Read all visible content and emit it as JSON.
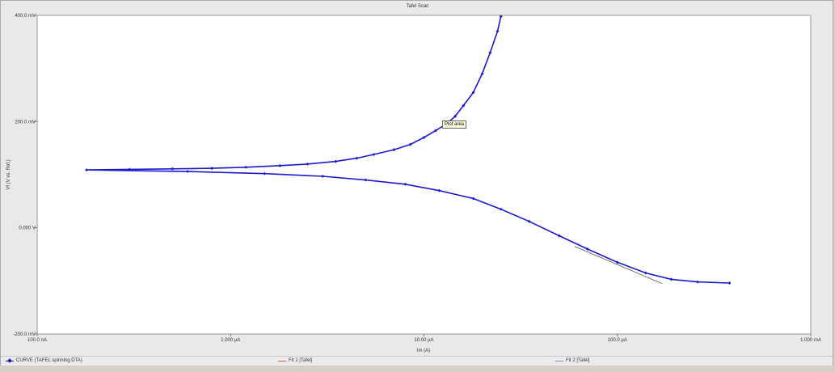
{
  "window": {
    "tooltip": "Plot area"
  },
  "legend": {
    "items": [
      {
        "label": "CURVE (TAFEL spinning.DTA)",
        "color": "#1a1acc",
        "marker": "diamond"
      },
      {
        "label": "Fit 1 [Tafel]",
        "color": "#e05050",
        "marker": "none"
      },
      {
        "label": "Fit 2 [Tafel]",
        "color": "#9080c0",
        "marker": "none"
      }
    ]
  },
  "chart_data": {
    "type": "line",
    "title": "Tafel Scan",
    "xlabel": "Im (A)",
    "ylabel": "Vf (V vs. Ref.)",
    "xscale": "log",
    "xlim": [
      1e-07,
      0.001
    ],
    "ylim": [
      -0.2,
      0.4
    ],
    "grid": false,
    "legend_position": "bottom",
    "x_ticks": [
      {
        "value": 1e-07,
        "label": "100.0 nA"
      },
      {
        "value": 1e-06,
        "label": "1.000 µA"
      },
      {
        "value": 1e-05,
        "label": "10.00 µA"
      },
      {
        "value": 0.0001,
        "label": "100.0 µA"
      },
      {
        "value": 0.001,
        "label": "1.000 mA"
      }
    ],
    "y_ticks": [
      {
        "value": 0.4,
        "label": "400.0 mV"
      },
      {
        "value": 0.2,
        "label": "200.0 mV"
      },
      {
        "value": 0.0,
        "label": "0.000 V"
      },
      {
        "value": -0.2,
        "label": "-200.0 mV"
      }
    ],
    "series": [
      {
        "name": "CURVE (TAFEL spinning.DTA)",
        "color": "#1a1acc",
        "x": [
          2.5e-05,
          2.4e-05,
          2.2e-05,
          2e-05,
          1.8e-05,
          1.6e-05,
          1.45e-05,
          1.3e-05,
          1.15e-05,
          1e-05,
          8.5e-06,
          7e-06,
          5.5e-06,
          4.5e-06,
          3.5e-06,
          2.5e-06,
          1.8e-06,
          1.2e-06,
          8e-07,
          5e-07,
          3e-07,
          1.8e-07,
          6e-07,
          1.5e-06,
          3e-06,
          5e-06,
          8e-06,
          1.2e-05,
          1.8e-05,
          2.5e-05,
          3.5e-05,
          5e-05,
          7e-05,
          0.0001,
          0.00014,
          0.00019,
          0.00026,
          0.00038
        ],
        "y": [
          0.398,
          0.37,
          0.33,
          0.29,
          0.255,
          0.23,
          0.21,
          0.195,
          0.183,
          0.17,
          0.157,
          0.147,
          0.138,
          0.131,
          0.125,
          0.12,
          0.117,
          0.114,
          0.112,
          0.111,
          0.11,
          0.109,
          0.106,
          0.102,
          0.097,
          0.09,
          0.082,
          0.07,
          0.055,
          0.035,
          0.012,
          -0.015,
          -0.04,
          -0.065,
          -0.085,
          -0.097,
          -0.102,
          -0.104
        ]
      },
      {
        "name": "Fit 2 [Tafel]",
        "color": "#555555",
        "x": [
          6e-05,
          0.00017
        ],
        "y": [
          -0.035,
          -0.105
        ]
      }
    ]
  }
}
